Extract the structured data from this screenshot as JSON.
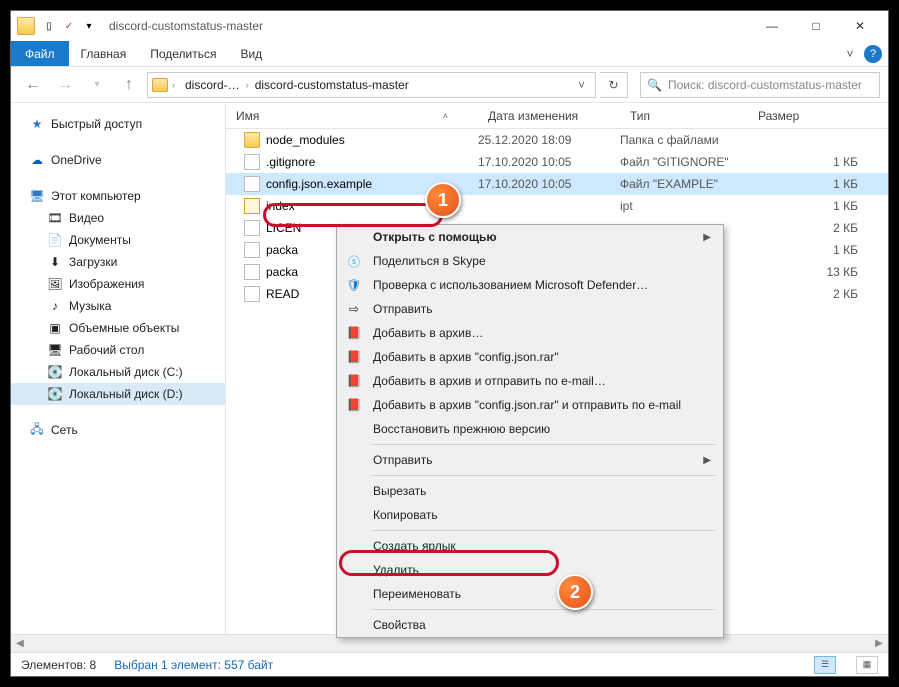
{
  "window": {
    "title": "discord-customstatus-master"
  },
  "ribbon": {
    "file": "Файл",
    "home": "Главная",
    "share": "Поделиться",
    "view": "Вид"
  },
  "breadcrumb": {
    "seg1": "discord-…",
    "seg2": "discord-customstatus-master"
  },
  "search": {
    "placeholder": "Поиск: discord-customstatus-master"
  },
  "sidebar": {
    "quick": "Быстрый доступ",
    "onedrive": "OneDrive",
    "thispc": "Этот компьютер",
    "video": "Видео",
    "docs": "Документы",
    "downloads": "Загрузки",
    "pictures": "Изображения",
    "music": "Музыка",
    "objects3d": "Объемные объекты",
    "desktop": "Рабочий стол",
    "diskc": "Локальный диск (C:)",
    "diskd": "Локальный диск (D:)",
    "network": "Сеть"
  },
  "columns": {
    "name": "Имя",
    "date": "Дата изменения",
    "type": "Тип",
    "size": "Размер"
  },
  "files": [
    {
      "name": "node_modules",
      "date": "25.12.2020 18:09",
      "type": "Папка с файлами",
      "size": ""
    },
    {
      "name": ".gitignore",
      "date": "17.10.2020 10:05",
      "type": "Файл \"GITIGNORE\"",
      "size": "1 КБ"
    },
    {
      "name": "config.json.example",
      "date": "17.10.2020 10:05",
      "type": "Файл \"EXAMPLE\"",
      "size": "1 КБ"
    },
    {
      "name": "index",
      "date": "",
      "type": "ipt",
      "size": "1 КБ"
    },
    {
      "name": "LICEN",
      "date": "",
      "type": "",
      "size": "2 КБ"
    },
    {
      "name": "packa",
      "date": "",
      "type": "",
      "size": "1 КБ"
    },
    {
      "name": "packa",
      "date": "",
      "type": "",
      "size": "13 КБ"
    },
    {
      "name": "READ",
      "date": "",
      "type": "",
      "size": "2 КБ"
    }
  ],
  "ctx": {
    "open_with": "Открыть с помощью",
    "skype": "Поделиться в Skype",
    "defender": "Проверка с использованием Microsoft Defender…",
    "send": "Отправить",
    "add_archive": "Добавить в архив…",
    "add_rar": "Добавить в архив \"config.json.rar\"",
    "add_send": "Добавить в архив и отправить по e-mail…",
    "add_rar_send": "Добавить в архив \"config.json.rar\" и отправить по e-mail",
    "restore": "Восстановить прежнюю версию",
    "send_to": "Отправить",
    "cut": "Вырезать",
    "copy": "Копировать",
    "shortcut": "Создать ярлык",
    "delete": "Удалить",
    "rename": "Переименовать",
    "props": "Свойства"
  },
  "status": {
    "items": "Элементов: 8",
    "selected": "Выбран 1 элемент: 557 байт"
  },
  "badges": {
    "one": "1",
    "two": "2"
  }
}
